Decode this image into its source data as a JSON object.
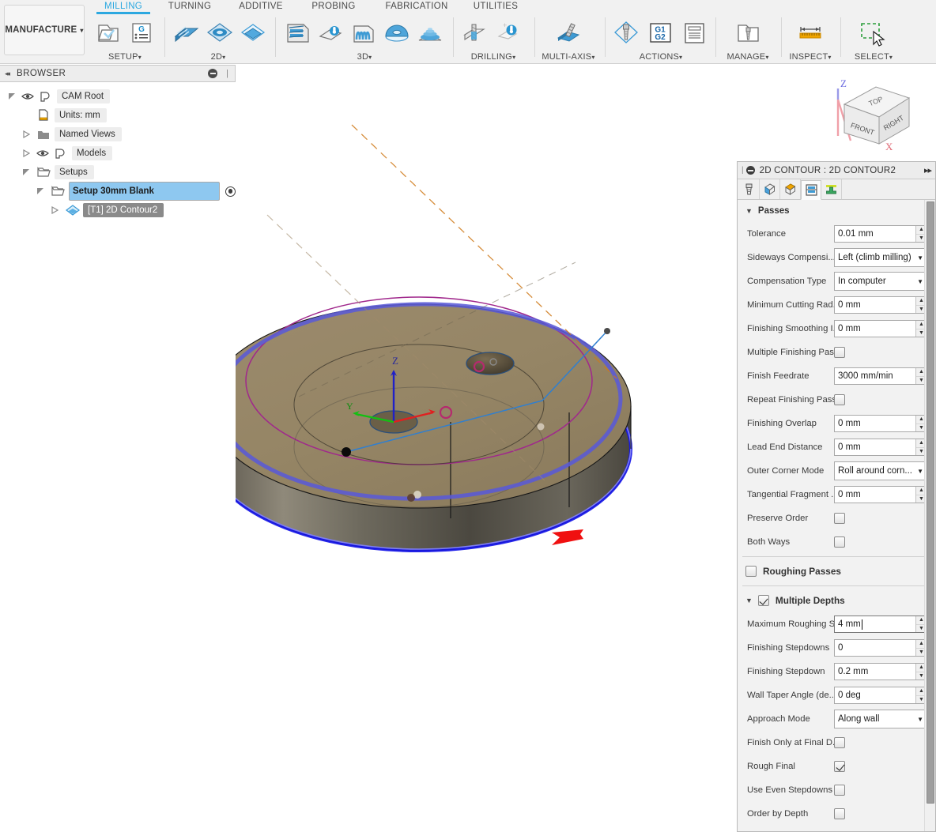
{
  "ribbon": {
    "workspace": {
      "label": "MANUFACTURE",
      "caret": "▾"
    },
    "tabs": [
      {
        "label": "MILLING",
        "active": true
      },
      {
        "label": "TURNING",
        "active": false
      },
      {
        "label": "ADDITIVE",
        "active": false
      },
      {
        "label": "PROBING",
        "active": false
      },
      {
        "label": "FABRICATION",
        "active": false
      },
      {
        "label": "UTILITIES",
        "active": false
      }
    ],
    "groups": [
      {
        "label": "SETUP",
        "caret": "▾"
      },
      {
        "label": "2D",
        "caret": "▾"
      },
      {
        "label": "3D",
        "caret": "▾"
      },
      {
        "label": "DRILLING",
        "caret": "▾"
      },
      {
        "label": "MULTI-AXIS",
        "caret": "▾"
      },
      {
        "label": "ACTIONS",
        "caret": "▾"
      },
      {
        "label": "MANAGE",
        "caret": "▾"
      },
      {
        "label": "INSPECT",
        "caret": "▾"
      },
      {
        "label": "SELECT",
        "caret": "▾"
      }
    ],
    "icons": [
      "setup-icon",
      "generate-nc-program-icon",
      "face-icon",
      "2d-adaptive-clearing-icon",
      "2d-pocket-icon",
      "2d-contour-icon",
      "adaptive-clearing-3d-icon",
      "parallel-3d-icon",
      "scallop-icon",
      "spiral-icon",
      "drill-icon",
      "probe-wcs-icon",
      "multi-axis-contour-icon",
      "manual-nc-icon",
      "g1g2-post-process-icon",
      "setup-sheet-icon",
      "tool-library-icon",
      "measure-icon",
      "select-window-icon"
    ]
  },
  "browser": {
    "title": "BROWSER",
    "collapse_glyph": "◂◂",
    "tree": [
      {
        "label": "CAM Root",
        "depth": 0,
        "triangle": "down",
        "eye": true,
        "icon": "body-icon",
        "state": "normal"
      },
      {
        "label": "Units: mm",
        "depth": 1,
        "triangle": "none",
        "eye": false,
        "icon": "document-icon",
        "state": "normal"
      },
      {
        "label": "Named Views",
        "depth": 1,
        "triangle": "right",
        "eye": false,
        "icon": "folder-icon",
        "state": "normal"
      },
      {
        "label": "Models",
        "depth": 1,
        "triangle": "right",
        "eye": true,
        "icon": "body-icon",
        "state": "normal"
      },
      {
        "label": "Setups",
        "depth": 1,
        "triangle": "down",
        "eye": false,
        "icon": "setup-folder-icon",
        "state": "normal"
      },
      {
        "label": "Setup 30mm Blank",
        "depth": 2,
        "triangle": "down",
        "eye": false,
        "icon": "setup-folder-icon",
        "state": "selected",
        "radio": true
      },
      {
        "label": "[T1] 2D Contour2",
        "depth": 3,
        "triangle": "right",
        "eye": false,
        "icon": "contour-op-icon",
        "state": "active-op"
      }
    ]
  },
  "viewport": {
    "viewcube": {
      "faces": {
        "top": "TOP",
        "front": "FRONT",
        "right": "RIGHT"
      },
      "axes": {
        "x": "X",
        "z": "Z"
      }
    },
    "origin_axes": {
      "x": "",
      "y": "Y",
      "z": "Z"
    },
    "annotation": "red-arrow-pointer"
  },
  "panel": {
    "header": {
      "title": "2D CONTOUR : 2D CONTOUR2",
      "grip": "|",
      "expand_glyph": "▸▸"
    },
    "tabs": [
      {
        "name": "tool-tab",
        "active": false
      },
      {
        "name": "geometry-tab",
        "active": false
      },
      {
        "name": "heights-tab",
        "active": false
      },
      {
        "name": "passes-tab",
        "active": true
      },
      {
        "name": "linking-tab",
        "active": false
      }
    ],
    "sections": [
      {
        "kind": "collapsible",
        "title": "Passes",
        "arrow": "▼",
        "expanded": true,
        "fields": [
          {
            "type": "spinner",
            "label": "Tolerance",
            "label_full": "Tolerance",
            "value": "0.01 mm",
            "focused": false
          },
          {
            "type": "select",
            "label": "Sideways Compensi...",
            "label_full": "Sideways Compensation",
            "value": "Left (climb milling)"
          },
          {
            "type": "select",
            "label": "Compensation Type",
            "label_full": "Compensation Type",
            "value": "In computer"
          },
          {
            "type": "spinner",
            "label": "Minimum Cutting Rad...",
            "label_full": "Minimum Cutting Radius",
            "value": "0 mm",
            "focused": false
          },
          {
            "type": "spinner",
            "label": "Finishing Smoothing I...",
            "label_full": "Finishing Smoothing Deviation",
            "value": "0 mm",
            "focused": false
          },
          {
            "type": "checkbox",
            "label": "Multiple Finishing Pas...",
            "label_full": "Multiple Finishing Passes",
            "checked": false
          },
          {
            "type": "spinner",
            "label": "Finish Feedrate",
            "label_full": "Finish Feedrate",
            "value": "3000 mm/min",
            "focused": false
          },
          {
            "type": "checkbox",
            "label": "Repeat Finishing Pass",
            "label_full": "Repeat Finishing Pass",
            "checked": false
          },
          {
            "type": "spinner",
            "label": "Finishing Overlap",
            "label_full": "Finishing Overlap",
            "value": "0 mm",
            "focused": false
          },
          {
            "type": "spinner",
            "label": "Lead End Distance",
            "label_full": "Lead End Distance",
            "value": "0 mm",
            "focused": false
          },
          {
            "type": "select",
            "label": "Outer Corner Mode",
            "label_full": "Outer Corner Mode",
            "value": "Roll around corn..."
          },
          {
            "type": "spinner",
            "label": "Tangential Fragment ...",
            "label_full": "Tangential Fragment Extension Distance",
            "value": "0 mm",
            "focused": false
          },
          {
            "type": "checkbox",
            "label": "Preserve Order",
            "label_full": "Preserve Order",
            "checked": false
          },
          {
            "type": "checkbox",
            "label": "Both Ways",
            "label_full": "Both Ways",
            "checked": false
          }
        ]
      },
      {
        "kind": "group",
        "title": "Roughing Passes",
        "checkbox": true,
        "checked": false,
        "arrow": "",
        "fields": []
      },
      {
        "kind": "group",
        "title": "Multiple Depths",
        "checkbox": true,
        "checked": true,
        "arrow": "▼",
        "fields": [
          {
            "type": "spinner",
            "label": "Maximum Roughing S...",
            "label_full": "Maximum Roughing Stepdown",
            "value": "4 mm",
            "focused": true
          },
          {
            "type": "spinner",
            "label": "Finishing Stepdowns",
            "label_full": "Finishing Stepdowns",
            "value": "0",
            "focused": false
          },
          {
            "type": "spinner",
            "label": "Finishing Stepdown",
            "label_full": "Finishing Stepdown",
            "value": "0.2 mm",
            "focused": false
          },
          {
            "type": "spinner",
            "label": "Wall Taper Angle (de...",
            "label_full": "Wall Taper Angle (deg)",
            "value": "0 deg",
            "focused": false
          },
          {
            "type": "select",
            "label": "Approach Mode",
            "label_full": "Approach Mode",
            "value": "Along wall"
          },
          {
            "type": "checkbox",
            "label": "Finish Only at Final D...",
            "label_full": "Finish Only at Final Depth",
            "checked": false
          },
          {
            "type": "checkbox",
            "label": "Rough Final",
            "label_full": "Rough Final",
            "checked": true
          },
          {
            "type": "checkbox",
            "label": "Use Even Stepdowns",
            "label_full": "Use Even Stepdowns",
            "checked": false
          },
          {
            "type": "checkbox",
            "label": "Order by Depth",
            "label_full": "Order by Depth",
            "checked": false
          }
        ]
      }
    ]
  },
  "colors": {
    "accent": "#2ca8e0",
    "selection_blue": "#8ec8f0",
    "toolpath_blue": "#1515e8",
    "stock_magenta": "#a0288c",
    "annotation_red": "#f01010",
    "axis_x": "#e02020",
    "axis_y": "#12c012",
    "axis_z": "#2020c8",
    "model_tan": "#8b7a60"
  }
}
